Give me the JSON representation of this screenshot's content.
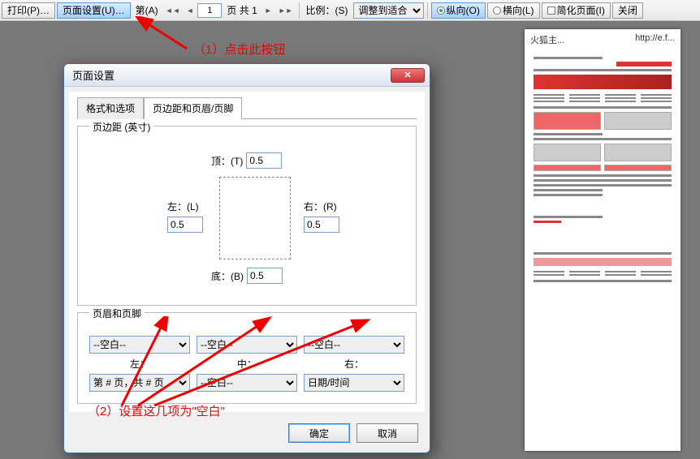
{
  "toolbar": {
    "print": "打印(P)…",
    "pageSetup": "页面设置(U)…",
    "pageLabel": "第(A)",
    "pageInput": "1",
    "pageOf": "页 共  1",
    "scaleLabel": "比例：(S)",
    "scaleSelect": "调整到适合",
    "portrait": "纵向(O)",
    "landscape": "横向(L)",
    "simplify": "简化页面(I)",
    "close": "关闭"
  },
  "preview": {
    "headLeft": "火狐主...",
    "headRight": "http://e.f..."
  },
  "dialog": {
    "title": "页面设置",
    "tabFormat": "格式和选项",
    "tabMargins": "页边距和页眉/页脚",
    "marginsLegend": "页边距 (英寸)",
    "topLabel": "顶：(T)",
    "leftLabel": "左：(L)",
    "rightLabel": "右：(R)",
    "bottomLabel": "底：(B)",
    "marginTop": "0.5",
    "marginLeft": "0.5",
    "marginRight": "0.5",
    "marginBottom": "0.5",
    "hfLegend": "页眉和页脚",
    "blank": "--空白--",
    "pageCount": "第 # 页，共 # 页",
    "datetime": "日期/时间",
    "colLeft": "左：",
    "colCenter": "中：",
    "colRight": "右：",
    "ok": "确定",
    "cancel": "取消"
  },
  "anno": {
    "a1": "（1）点击此按钮",
    "a2": "（2）设置这几项为\"空白\""
  }
}
